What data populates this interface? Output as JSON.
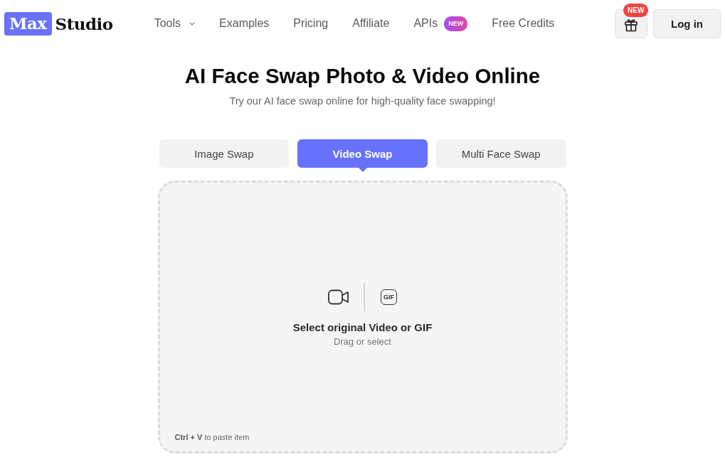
{
  "header": {
    "logo": {
      "mark": "Max",
      "text": "Studio"
    },
    "nav": [
      {
        "label": "Tools",
        "kind": "dropdown"
      },
      {
        "label": "Examples",
        "kind": "link"
      },
      {
        "label": "Pricing",
        "kind": "link"
      },
      {
        "label": "Affiliate",
        "kind": "link"
      },
      {
        "label": "APIs",
        "kind": "link",
        "badge": "NEW"
      },
      {
        "label": "Free Credits",
        "kind": "link"
      }
    ],
    "gift_badge": "NEW",
    "login": "Log in"
  },
  "hero": {
    "title": "AI Face Swap Photo & Video Online",
    "subtitle": "Try our AI face swap online for high-quality face swapping!"
  },
  "tabs": [
    {
      "label": "Image Swap",
      "selected": false
    },
    {
      "label": "Video Swap",
      "selected": true
    },
    {
      "label": "Multi Face Swap",
      "selected": false
    }
  ],
  "dropzone": {
    "gif_icon_text": "GIF",
    "title": "Select original Video or GIF",
    "hint": "Drag or select",
    "paste_hint": "**Ctrl + V** to paste item"
  }
}
